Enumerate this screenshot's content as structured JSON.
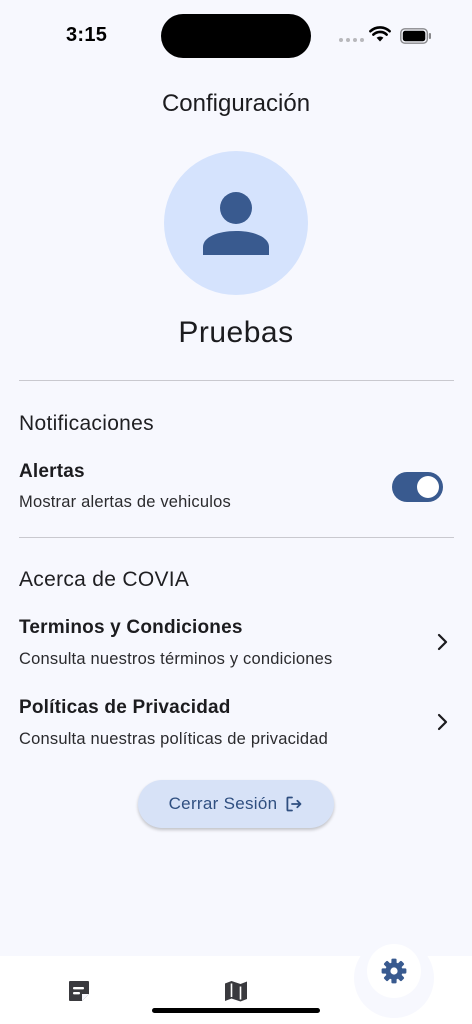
{
  "status_bar": {
    "time": "3:15"
  },
  "header": {
    "title": "Configuración"
  },
  "profile": {
    "name": "Pruebas",
    "avatar_icon": "person-icon"
  },
  "notifications": {
    "section_title": "Notificaciones",
    "alerts": {
      "title": "Alertas",
      "subtitle": "Mostrar alertas de vehiculos",
      "enabled": true
    }
  },
  "about": {
    "section_title": "Acerca de COVIA",
    "items": [
      {
        "title": "Terminos y Condiciones",
        "subtitle": "Consulta nuestros términos y condiciones"
      },
      {
        "title": "Políticas de Privacidad",
        "subtitle": "Consulta nuestras políticas de privacidad"
      }
    ]
  },
  "logout": {
    "label": "Cerrar Sesión",
    "icon": "logout-icon"
  },
  "bottom_nav": {
    "items": [
      {
        "icon": "note-icon",
        "active": false
      },
      {
        "icon": "map-icon",
        "active": false
      },
      {
        "icon": "gear-icon",
        "active": true
      }
    ]
  },
  "colors": {
    "primary": "#395a8f",
    "avatar_bg": "#d5e3fd",
    "button_bg": "#d7e2f7",
    "page_bg": "#f7f8fe"
  }
}
